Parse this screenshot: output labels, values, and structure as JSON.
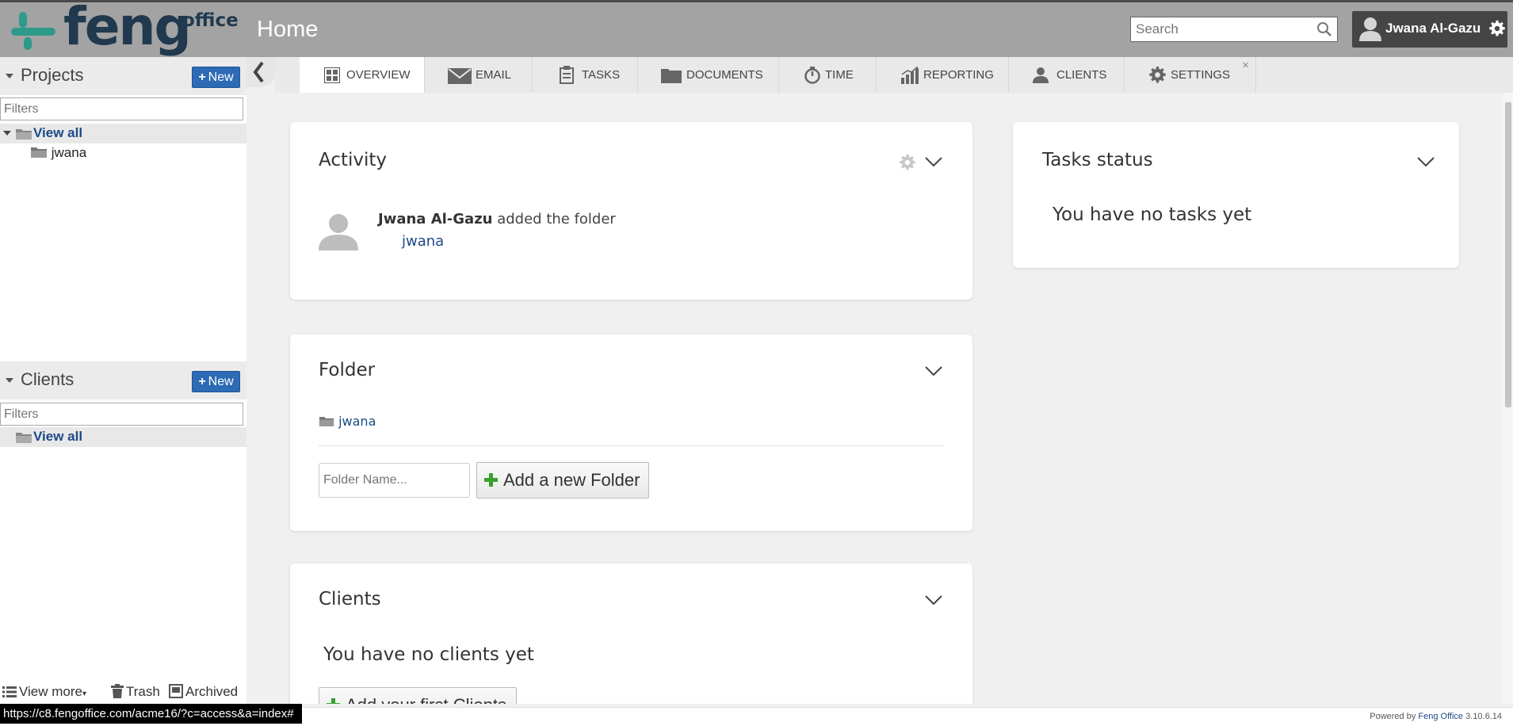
{
  "header": {
    "logo_text": "feng",
    "logo_sub": "office",
    "page_title": "Home",
    "search_placeholder": "Search",
    "user_name": "Jwana Al-Gazu"
  },
  "sidebar": {
    "projects": {
      "title": "Projects",
      "new_label": "New",
      "filter_placeholder": "Filters",
      "view_all": "View all",
      "items": [
        "jwana"
      ]
    },
    "clients": {
      "title": "Clients",
      "new_label": "New",
      "filter_placeholder": "Filters",
      "view_all": "View all"
    },
    "footer": {
      "view_more": "View more",
      "trash": "Trash",
      "archived": "Archived"
    }
  },
  "tabs": [
    {
      "label": "OVERVIEW",
      "icon": "overview-icon",
      "active": true
    },
    {
      "label": "EMAIL",
      "icon": "email-icon"
    },
    {
      "label": "TASKS",
      "icon": "tasks-icon"
    },
    {
      "label": "DOCUMENTS",
      "icon": "documents-icon"
    },
    {
      "label": "TIME",
      "icon": "time-icon"
    },
    {
      "label": "REPORTING",
      "icon": "reporting-icon"
    },
    {
      "label": "CLIENTS",
      "icon": "clients-icon"
    },
    {
      "label": "SETTINGS",
      "icon": "settings-icon"
    }
  ],
  "activity": {
    "title": "Activity",
    "entry": {
      "user": "Jwana Al-Gazu",
      "action": "added the folder",
      "object": "jwana"
    }
  },
  "folder": {
    "title": "Folder",
    "item": "jwana",
    "input_placeholder": "Folder Name...",
    "add_button": "Add a new Folder"
  },
  "clients_widget": {
    "title": "Clients",
    "empty_text": "You have no clients yet",
    "add_button": "Add your first Clients"
  },
  "tasks_status": {
    "title": "Tasks status",
    "empty_text": "You have no tasks yet"
  },
  "status_bar": {
    "url": "https://c8.fengoffice.com/acme16/?c=access&a=index#",
    "powered_prefix": "Powered by",
    "powered_brand": "Feng Office",
    "version": "3.10.6.14"
  },
  "colors": {
    "header_bg": "#a3a3a3",
    "brand_blue": "#2d6bb4",
    "link": "#1c4a86",
    "logo_dark": "#20394e",
    "logo_teal": "#2e9a8a"
  }
}
